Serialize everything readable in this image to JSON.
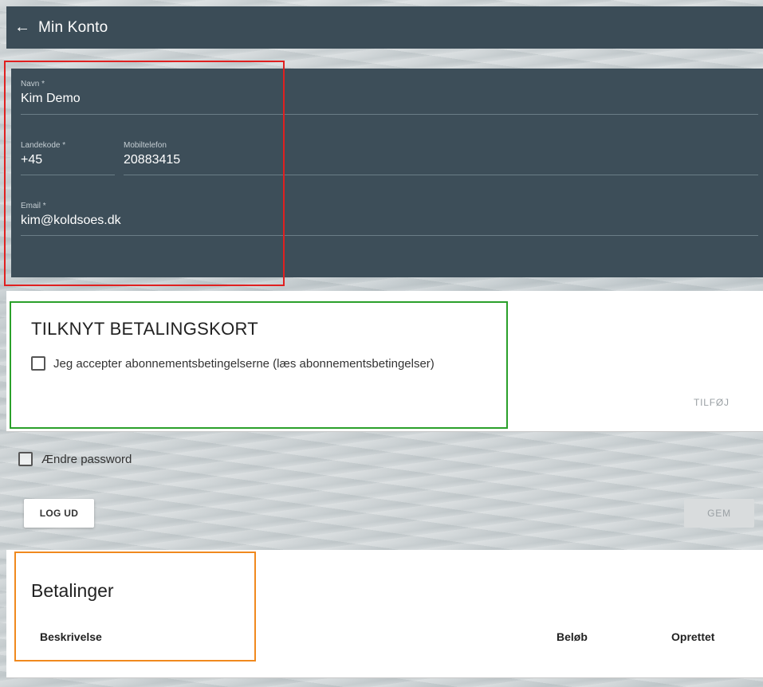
{
  "header": {
    "back_icon": "arrow-left-icon",
    "title": "Min Konto"
  },
  "profile": {
    "name_label": "Navn *",
    "name_value": "Kim Demo",
    "country_code_label": "Landekode *",
    "country_code_value": "+45",
    "mobile_label": "Mobiltelefon",
    "mobile_value": "20883415",
    "email_label": "Email *",
    "email_value": "kim@koldsoes.dk"
  },
  "payment_card": {
    "title": "TILKNYT BETALINGSKORT",
    "terms_label": "Jeg accepter abonnementsbetingelserne (læs abonnementsbetingelser)",
    "terms_checked": false,
    "add_label": "TILFØJ"
  },
  "account_actions": {
    "change_password_label": "Ændre password",
    "change_password_checked": false,
    "logout_label": "LOG UD",
    "save_label": "GEM"
  },
  "payments": {
    "title": "Betalinger",
    "columns": [
      "Beskrivelse",
      "Beløb",
      "Oprettet"
    ]
  },
  "colors": {
    "header_bg": "#3b4c57",
    "panel_bg": "#3d4e59",
    "highlight_red": "#e02020",
    "highlight_green": "#2aa02a",
    "highlight_orange": "#f0891e"
  }
}
